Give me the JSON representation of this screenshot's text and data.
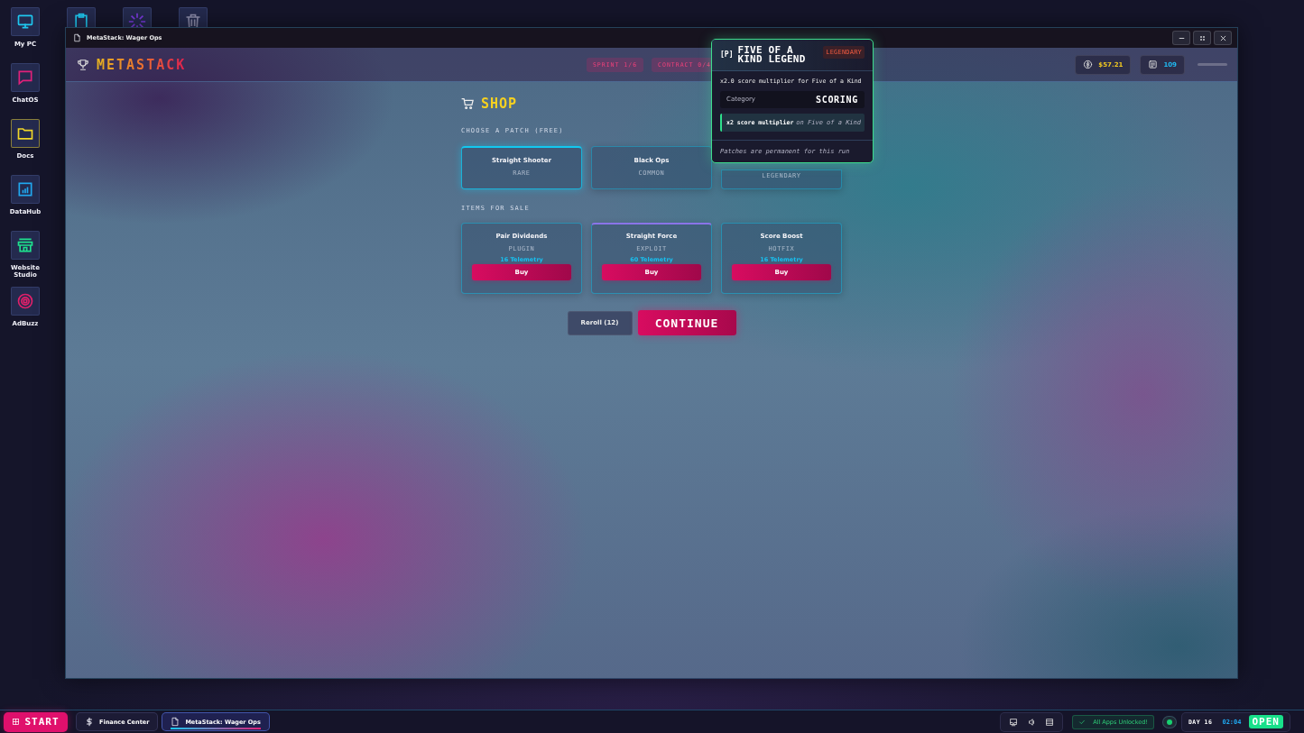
{
  "desktop_icons": [
    {
      "label": "My PC"
    },
    {
      "label": "ChatOS"
    },
    {
      "label": "Docs"
    },
    {
      "label": "DataHub"
    },
    {
      "label": "Website Studio"
    },
    {
      "label": "AdBuzz"
    }
  ],
  "window": {
    "title": "MetaStack: Wager Ops"
  },
  "app_header": {
    "logo": "METASTACK",
    "badges": [
      "SPRINT 1/6",
      "CONTRACT 0/4"
    ],
    "money": "$57.21",
    "telemetry": "109"
  },
  "shop": {
    "title": "SHOP",
    "patch_heading": "CHOOSE A PATCH (FREE)",
    "patches": [
      {
        "name": "Straight Shooter",
        "rarity": "RARE",
        "selected": true
      },
      {
        "name": "Black Ops",
        "rarity": "COMMON",
        "selected": false
      },
      {
        "rarity": "LEGENDARY",
        "selected": false
      }
    ],
    "items_heading": "ITEMS FOR SALE",
    "items": [
      {
        "name": "Pair Dividends",
        "type": "PLUGIN",
        "price": "16 Telemetry",
        "buy": "Buy",
        "highlighted": false
      },
      {
        "name": "Straight Force",
        "type": "EXPLOIT",
        "price": "60 Telemetry",
        "buy": "Buy",
        "highlighted": true
      },
      {
        "name": "Score Boost",
        "type": "HOTFIX",
        "price": "16 Telemetry",
        "buy": "Buy",
        "highlighted": false
      }
    ],
    "reroll": "Reroll (12)",
    "continue": "CONTINUE"
  },
  "tooltip": {
    "prefix": "[P]",
    "title": "FIVE OF A KIND LEGEND",
    "rarity": "LEGENDARY",
    "description": "x2.0 score multiplier for Five of a Kind",
    "category_label": "Category",
    "category": "SCORING",
    "effect": "x2 score multiplier",
    "effect_condition": "on Five of a Kind",
    "footer": "Patches are permanent for this run"
  },
  "taskbar": {
    "start": "START",
    "apps": [
      {
        "label": "Finance Center",
        "selected": false
      },
      {
        "label": "MetaStack: Wager Ops",
        "selected": true
      }
    ],
    "notice": "All Apps Unlocked!",
    "day": "DAY 16",
    "time": "02:04",
    "status": "OPEN"
  }
}
